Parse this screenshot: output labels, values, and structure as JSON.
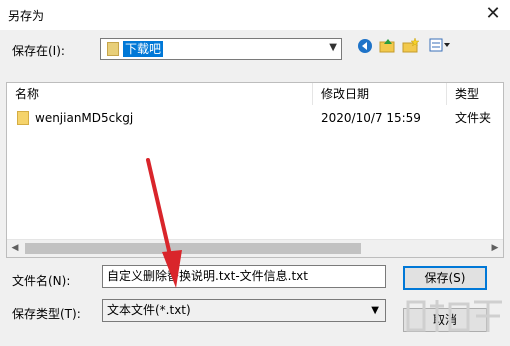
{
  "window": {
    "title": "另存为",
    "close_glyph": "✕"
  },
  "save_in": {
    "label": "保存在(I):",
    "folder": "下载吧"
  },
  "toolbar": {
    "back_icon": "back-icon",
    "up_icon": "up-folder-icon",
    "new_folder_icon": "new-folder-icon",
    "views_icon": "views-menu-icon"
  },
  "list": {
    "columns": [
      "名称",
      "修改日期",
      "类型"
    ],
    "rows": [
      {
        "name": "wenjianMD5ckgj",
        "modified": "2020/10/7 15:59",
        "type": "文件夹"
      }
    ]
  },
  "file_name": {
    "label": "文件名(N):",
    "value": "自定义删除替换说明.txt-文件信息.txt"
  },
  "save_type": {
    "label": "保存类型(T):",
    "value": "文本文件(*.txt)"
  },
  "buttons": {
    "save": "保存(S)",
    "cancel": "取消"
  },
  "annotation": {
    "arrow_color": "#d9252b"
  },
  "colors": {
    "selection": "#0078d7",
    "background": "#f0f0f0"
  }
}
